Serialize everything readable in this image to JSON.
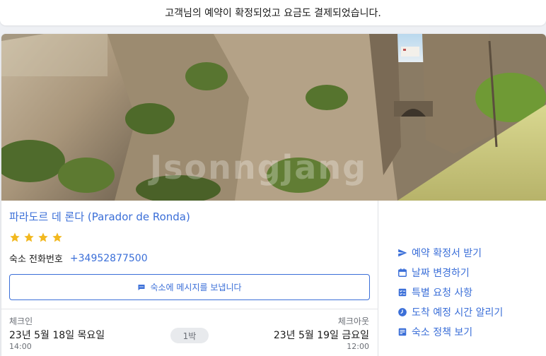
{
  "banner": {
    "message": "고객님의 예약이 확정되었고 요금도 결제되었습니다."
  },
  "hotel": {
    "image_alt": "Ronda gorge with Puente Nuevo bridge",
    "watermark": "Jsonngjang",
    "name": "파라도르 데 론다 (Parador de Ronda)",
    "stars": 4,
    "phone_label": "숙소 전화번호",
    "phone_number": "+34952877500",
    "message_button": "숙소에 메시지를 보냅니다"
  },
  "stay": {
    "checkin_label": "체크인",
    "checkin_date": "23년 5월 18일 목요일",
    "checkin_time": "14:00",
    "nights": "1박",
    "checkout_label": "체크아웃",
    "checkout_date": "23년 5월 19일 금요일",
    "checkout_time": "12:00"
  },
  "actions": [
    {
      "label": "예약 확정서 받기",
      "icon": "send-icon"
    },
    {
      "label": "날짜 변경하기",
      "icon": "calendar-icon"
    },
    {
      "label": "특별 요청 사항",
      "icon": "checklist-icon"
    },
    {
      "label": "도착 예정 시간 알리기",
      "icon": "clock-icon"
    },
    {
      "label": "숙소 정책 보기",
      "icon": "policy-icon"
    }
  ],
  "colors": {
    "accent": "#3b6fd8",
    "star": "#f2b81f",
    "muted": "#6b6f76"
  }
}
